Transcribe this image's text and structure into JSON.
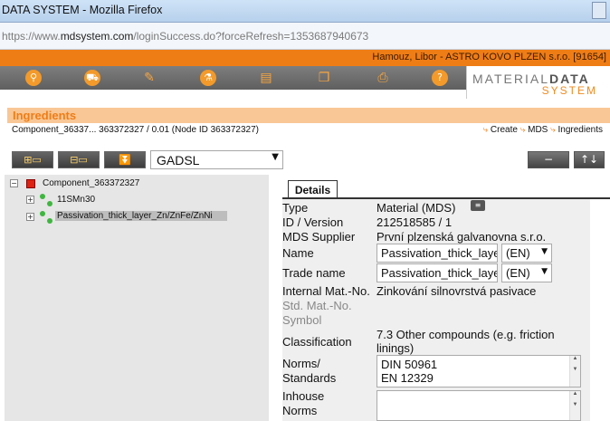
{
  "window": {
    "title": "DATA SYSTEM - Mozilla Firefox"
  },
  "browser": {
    "url_prefix": "https://www.",
    "url_domain": "mdsystem.com",
    "url_rest": "/loginSuccess.do?forceRefresh=1353687940673"
  },
  "userbar": {
    "text": "Hamouz, Libor   -   ASTRO KOVO PLZEN s.r.o. [91654]"
  },
  "nav": {
    "icons": [
      "search-icon",
      "car-icon",
      "edit-icon",
      "flask-icon",
      "document-icon",
      "copy-icon",
      "printer-icon",
      "help-icon"
    ]
  },
  "logo": {
    "line1_a": "MATERIAL",
    "line1_b": "DATA",
    "line2": "SYSTEM"
  },
  "ingredients": {
    "title": "Ingredients",
    "component_line": "Component_36337... 363372327 / 0.01 (Node ID 363372327)",
    "breadcrumb": [
      "Create",
      "MDS",
      "Ingredients"
    ]
  },
  "toolbar": {
    "filter_value": "GADSL",
    "remove_label": "−",
    "sort_label": "↑↓"
  },
  "tree": {
    "root": "Component_363372327",
    "children": [
      "11SMn30",
      "Passivation_thick_layer_Zn/ZnFe/ZnNi"
    ]
  },
  "details": {
    "tab_label": "Details",
    "type_label": "Type",
    "type_value": "Material (MDS)",
    "id_label": "ID / Version",
    "id_value": "212518585 / 1",
    "supplier_label": "MDS Supplier",
    "supplier_value": "První plzenská galvanovna s.r.o.",
    "name_label": "Name",
    "name_value": "Passivation_thick_layer",
    "name_lang": "(EN)",
    "trade_label": "Trade name",
    "trade_value": "Passivation_thick_layer",
    "trade_lang": "(EN)",
    "internal_label": "Internal Mat.-No.",
    "internal_value": "Zinkování silnovrstvá pasivace",
    "std_label_1": "Std. Mat.-No.",
    "std_label_2": "Symbol",
    "class_label": "Classification",
    "class_value_1": "7.3 Other compounds (e.g. friction",
    "class_value_2": "linings)",
    "norms_label_1": "Norms/",
    "norms_label_2": "Standards",
    "norms_values": [
      "DIN 50961",
      "EN 12329"
    ],
    "inhouse_label_1": "Inhouse",
    "inhouse_label_2": "Norms"
  }
}
